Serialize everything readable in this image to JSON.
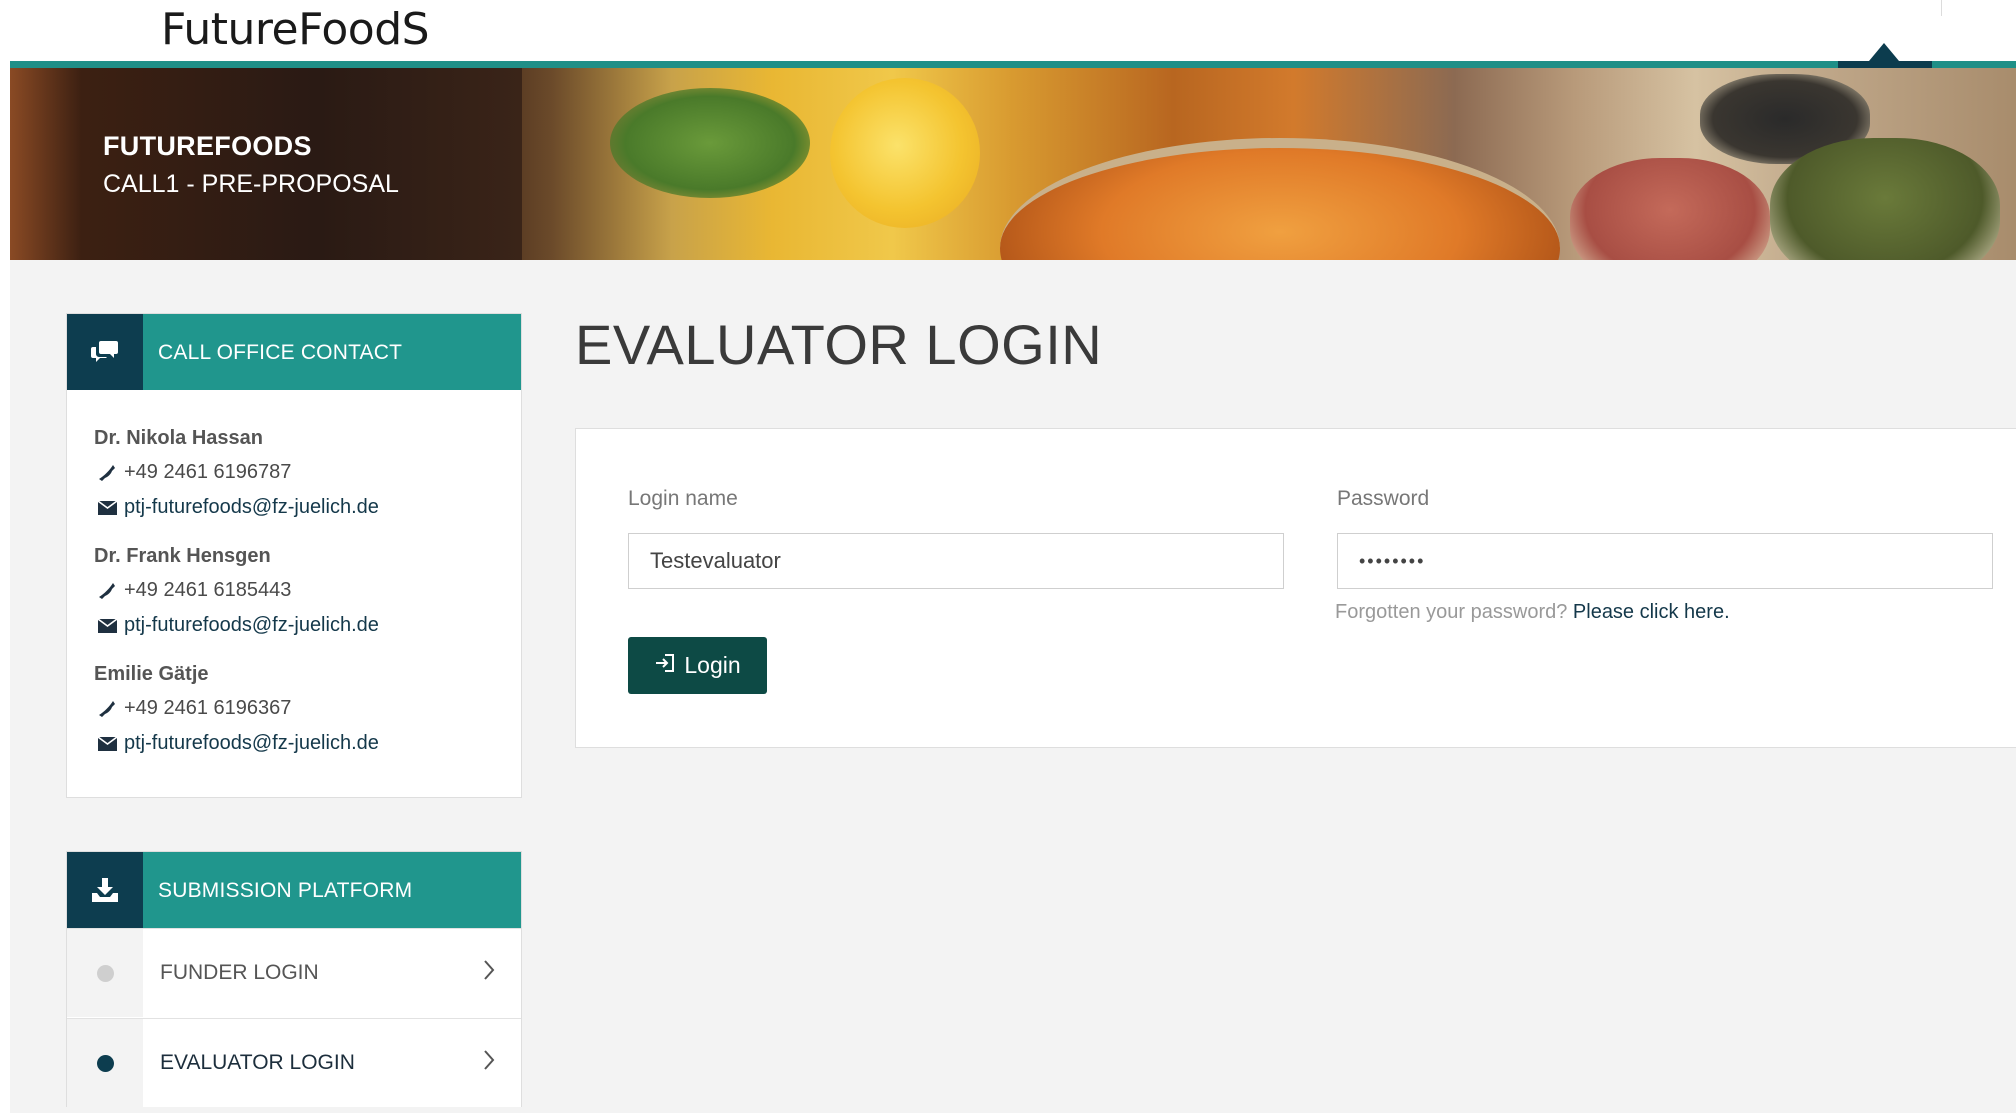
{
  "header": {
    "logo": "FutureFoodS"
  },
  "banner": {
    "title": "FUTUREFOODS",
    "subtitle": "CALL1 - PRE-PROPOSAL"
  },
  "contact_panel": {
    "title": "CALL OFFICE CONTACT",
    "icon": "chat-icon",
    "contacts": [
      {
        "name": "Dr. Nikola Hassan",
        "phone": "+49 2461 6196787",
        "email": "ptj-futurefoods@fz-juelich.de"
      },
      {
        "name": "Dr. Frank Hensgen",
        "phone": "+49 2461 6185443",
        "email": "ptj-futurefoods@fz-juelich.de"
      },
      {
        "name": "Emilie Gätje",
        "phone": "+49 2461 6196367",
        "email": "ptj-futurefoods@fz-juelich.de"
      }
    ]
  },
  "submission_panel": {
    "title": "SUBMISSION PLATFORM",
    "icon": "download-icon",
    "items": [
      {
        "label": "FUNDER LOGIN",
        "active": false
      },
      {
        "label": "EVALUATOR LOGIN",
        "active": true
      }
    ]
  },
  "main": {
    "page_title": "EVALUATOR LOGIN",
    "login_label": "Login name",
    "login_value": "Testevaluator",
    "password_label": "Password",
    "password_value": "••••••••",
    "forgot_text": "Forgotten your password?",
    "forgot_link": "Please click here.",
    "login_button": "Login"
  },
  "colors": {
    "teal": "#20968d",
    "dark_teal": "#0d3d4f",
    "button": "#0d4a45",
    "inactive_dot": "#cfcfcf",
    "active_dot": "#0d3d4f"
  }
}
